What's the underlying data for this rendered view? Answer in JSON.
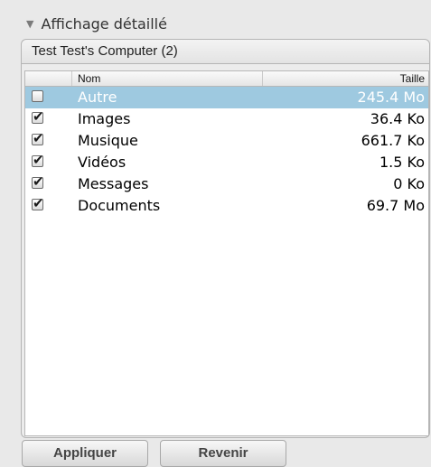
{
  "section": {
    "title": "Affichage détaillé",
    "group_title": "Test Test's Computer (2)"
  },
  "table": {
    "columns": {
      "name": "Nom",
      "size": "Taille"
    },
    "rows": [
      {
        "checked": false,
        "selected": true,
        "name": "Autre",
        "size": "245.4 Mo"
      },
      {
        "checked": true,
        "selected": false,
        "name": "Images",
        "size": "36.4 Ko"
      },
      {
        "checked": true,
        "selected": false,
        "name": "Musique",
        "size": "661.7 Ko"
      },
      {
        "checked": true,
        "selected": false,
        "name": "Vidéos",
        "size": "1.5 Ko"
      },
      {
        "checked": true,
        "selected": false,
        "name": "Messages",
        "size": "0 Ko"
      },
      {
        "checked": true,
        "selected": false,
        "name": "Documents",
        "size": "69.7 Mo"
      }
    ]
  },
  "buttons": {
    "apply": "Appliquer",
    "revert": "Revenir"
  },
  "colors": {
    "selection": "#9ec9e0"
  }
}
